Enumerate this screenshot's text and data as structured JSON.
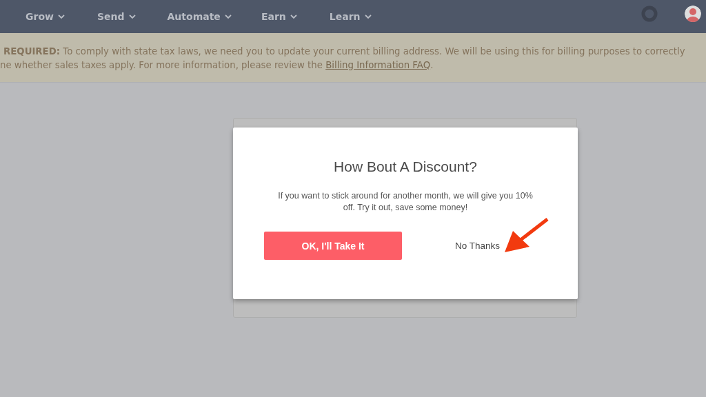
{
  "nav": {
    "items": [
      {
        "label": "Grow"
      },
      {
        "label": "Send"
      },
      {
        "label": "Automate"
      },
      {
        "label": "Earn"
      },
      {
        "label": "Learn"
      }
    ]
  },
  "banner": {
    "line_1": "**REQUIRED:** To comply with state tax laws, we need you to update your current billing address. We will be using this for billing purposes to correctly",
    "line_2": {
      "text": "ne whether sales taxes apply. For more information, please review the ",
      "link": "Billing Information FAQ",
      "after": "."
    }
  },
  "modal": {
    "title": "How Bout A Discount?",
    "message": "If you want to stick around for another month, we will give you 10% off. Try it out, save some money!",
    "accept_button": "OK, I'll Take It",
    "decline_link": "No Thanks"
  }
}
